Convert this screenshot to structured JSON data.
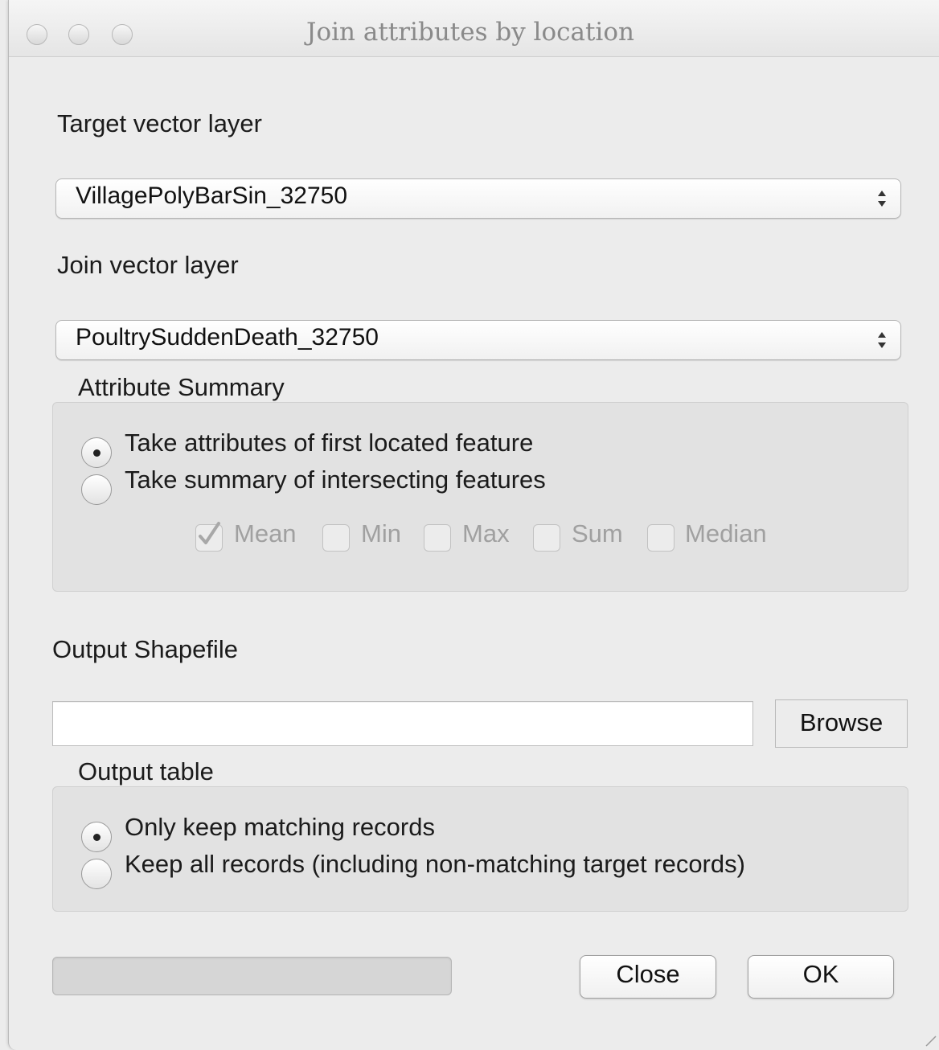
{
  "window": {
    "title": "Join attributes by location"
  },
  "target_layer": {
    "label": "Target vector layer",
    "selected": "VillagePolyBarSin_32750"
  },
  "join_layer": {
    "label": "Join vector layer",
    "selected": "PoultrySuddenDeath_32750"
  },
  "attribute_summary": {
    "title": "Attribute Summary",
    "options": [
      {
        "label": "Take attributes of first located feature",
        "selected": true
      },
      {
        "label": "Take summary of intersecting features",
        "selected": false
      }
    ],
    "stats": [
      {
        "label": "Mean",
        "checked": true
      },
      {
        "label": "Min",
        "checked": false
      },
      {
        "label": "Max",
        "checked": false
      },
      {
        "label": "Sum",
        "checked": false
      },
      {
        "label": "Median",
        "checked": false
      }
    ]
  },
  "output_shapefile": {
    "label": "Output Shapefile",
    "value": "",
    "browse_label": "Browse"
  },
  "output_table": {
    "title": "Output table",
    "options": [
      {
        "label": "Only keep matching records",
        "selected": true
      },
      {
        "label": "Keep all records (including non-matching target records)",
        "selected": false
      }
    ]
  },
  "footer": {
    "progress": 0,
    "close_label": "Close",
    "ok_label": "OK"
  }
}
